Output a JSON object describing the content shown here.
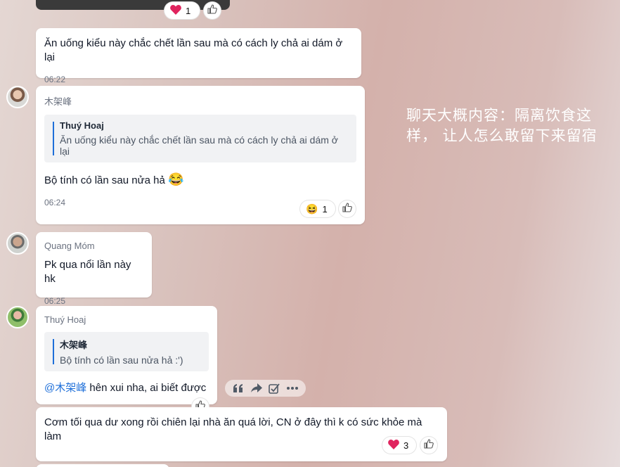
{
  "top_reaction": {
    "emoji": "heart",
    "count": "1"
  },
  "messages": [
    {
      "text": "Ăn uống kiểu này chắc chết lần sau mà có cách ly chả ai dám ở lại",
      "time": "06:22"
    },
    {
      "sender": "木架峰",
      "quote_name": "Thuý Hoaj",
      "quote_text": "Ăn uống kiểu này chắc chết lần sau mà có cách ly chả ai dám ở lại",
      "text": "Bộ tính có lần sau nửa hả",
      "emoji": "😂",
      "time": "06:24",
      "reaction_count": "1"
    },
    {
      "sender": "Quang Móm",
      "text": "Pk qua nổi lần này hk",
      "time": "06:25"
    },
    {
      "sender": "Thuý Hoaj",
      "quote_name": "木架峰",
      "quote_text": "Bộ tính có lần sau nửa hả :')",
      "mention": "@木架峰",
      "text": " hên xui nha,  ai biết được"
    },
    {
      "text": "Cơm tối qua dư xong rồi chiên lại nhà ăn quá lời, CN ở đây thì k có sức khỏe mà làm",
      "reaction_count": "3"
    }
  ],
  "overlay_text": "聊天大概内容：隔离饮食这样， 让人怎么敢留下来留宿",
  "colors": {
    "mention": "#1e6fd9",
    "heart": "#e0245e"
  }
}
